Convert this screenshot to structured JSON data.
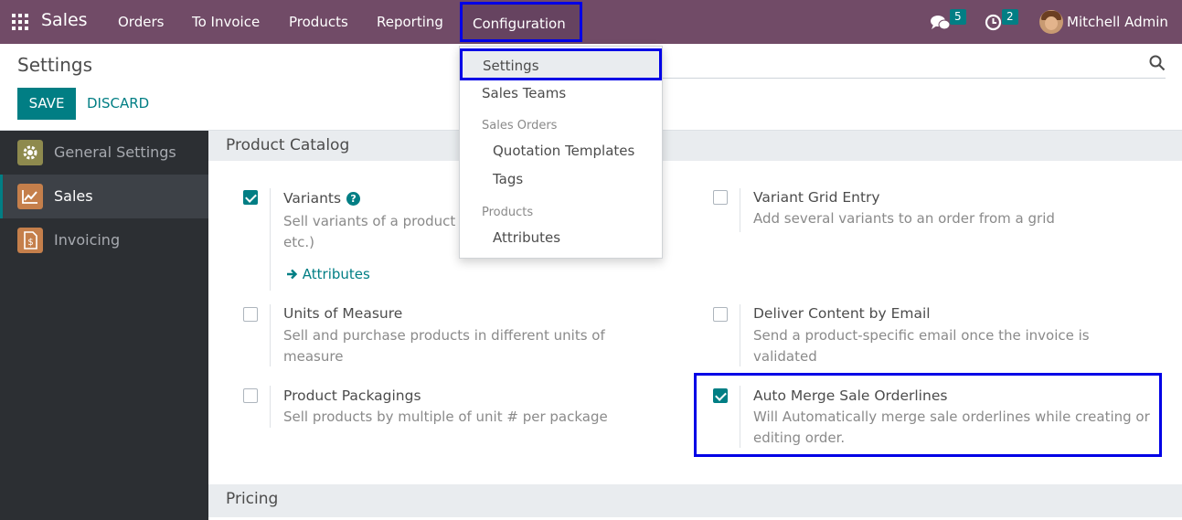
{
  "navbar": {
    "app_name": "Sales",
    "menus": [
      "Orders",
      "To Invoice",
      "Products",
      "Reporting"
    ],
    "configuration": "Configuration",
    "messages_count": "5",
    "activities_count": "2",
    "user_name": "Mitchell Admin"
  },
  "control": {
    "title": "Settings",
    "save_label": "SAVE",
    "discard_label": "DISCARD"
  },
  "sidebar": {
    "items": [
      {
        "label": "General Settings",
        "color": "#8e8a4e"
      },
      {
        "label": "Sales",
        "color": "#c57f4b"
      },
      {
        "label": "Invoicing",
        "color": "#c57f4b"
      }
    ]
  },
  "dropdown": {
    "settings": "Settings",
    "sales_teams": "Sales Teams",
    "sales_orders_header": "Sales Orders",
    "quotation_templates": "Quotation Templates",
    "tags": "Tags",
    "products_header": "Products",
    "attributes": "Attributes"
  },
  "sections": {
    "product_catalog": "Product Catalog",
    "pricing": "Pricing"
  },
  "settings": {
    "variants": {
      "title": "Variants",
      "desc": "Sell variants of a product using attributes (size, color, etc.)",
      "link": "Attributes",
      "checked": true
    },
    "variant_grid": {
      "title": "Variant Grid Entry",
      "desc": "Add several variants to an order from a grid",
      "checked": false
    },
    "uom": {
      "title": "Units of Measure",
      "desc": "Sell and purchase products in different units of measure",
      "checked": false
    },
    "deliver_email": {
      "title": "Deliver Content by Email",
      "desc": "Send a product-specific email once the invoice is validated",
      "checked": false
    },
    "packagings": {
      "title": "Product Packagings",
      "desc": "Sell products by multiple of unit # per package",
      "checked": false
    },
    "auto_merge": {
      "title": "Auto Merge Sale Orderlines",
      "desc": "Will Automatically merge sale orderlines while creating or editing order.",
      "checked": true
    }
  }
}
